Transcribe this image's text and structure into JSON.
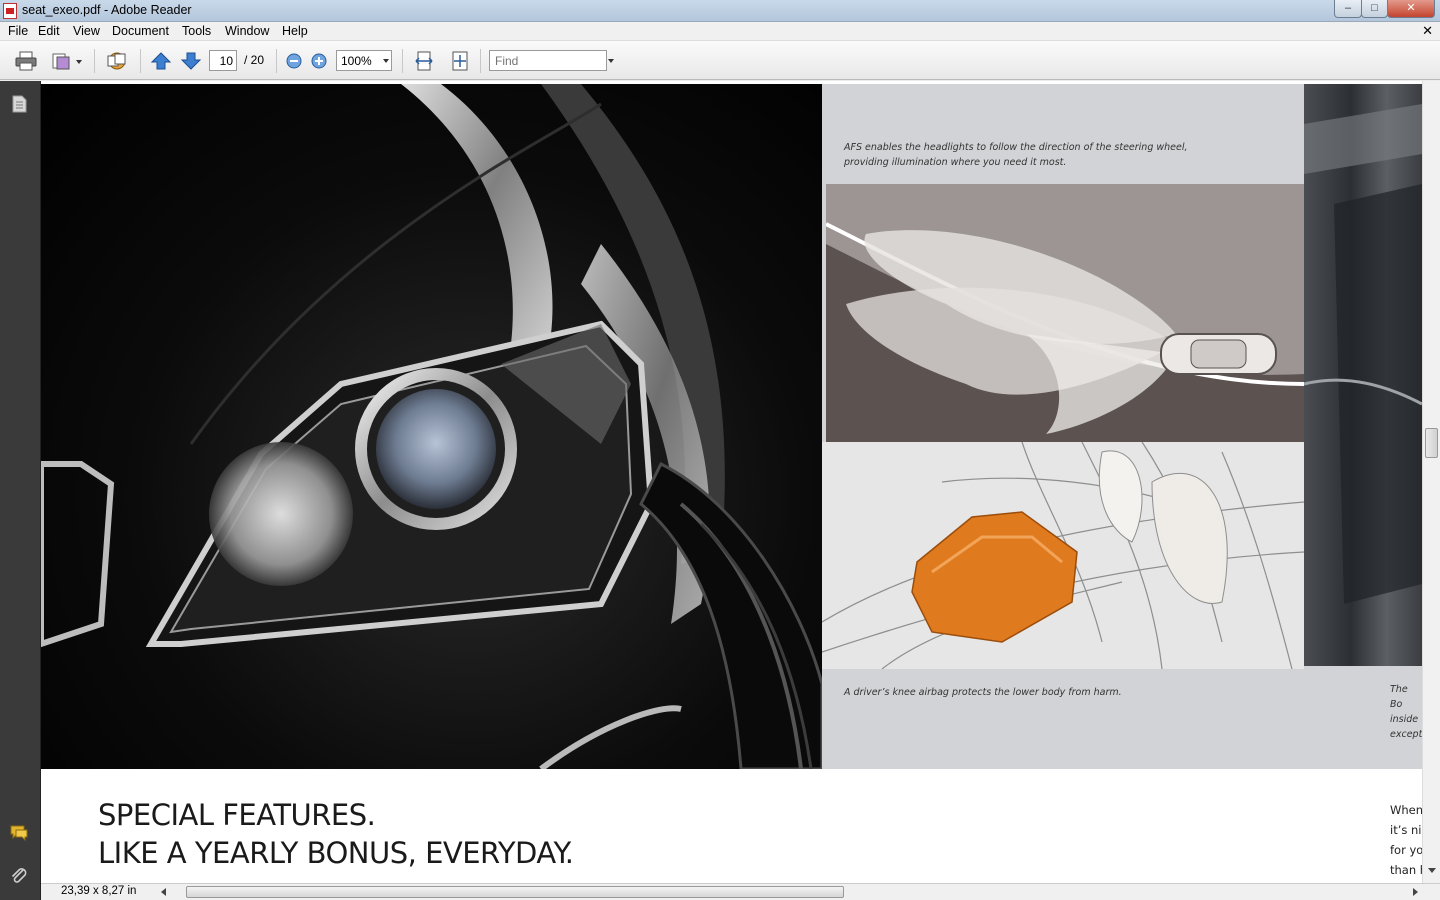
{
  "window": {
    "title": "seat_exeo.pdf - Adobe Reader",
    "controls": {
      "minimize": "–",
      "maximize": "□",
      "close": "✕"
    }
  },
  "menu": {
    "items": [
      "File",
      "Edit",
      "View",
      "Document",
      "Tools",
      "Window",
      "Help"
    ],
    "close": "✕"
  },
  "toolbar": {
    "icons": [
      "print-icon",
      "pages-icon",
      "collaborate-icon",
      "previous-page-icon",
      "next-page-icon",
      "zoom-out-icon",
      "zoom-in-icon",
      "fit-width-icon",
      "fit-page-icon"
    ],
    "page_current": "10",
    "page_total": "/ 20",
    "zoom": "100%",
    "find_placeholder": "Find"
  },
  "document": {
    "caption_afs": "AFS enables the headlights to follow the direction of the steering wheel,\nproviding illumination where you need it most.",
    "caption_airbag": "A driver’s knee airbag protects the lower body from harm.",
    "caption_right_cut": "The Bo\ninside \nexcept",
    "headline_line1": "SPECIAL FEATURES.",
    "headline_line2": "LIKE A YEARLY BONUS, EVERYDAY.",
    "body_cut": "When\nit’s ni\nfor yo\nthan h"
  },
  "status": {
    "page_size": "23,39 x 8,27 in"
  },
  "colors": {
    "airbag_accent": "#e07a1f",
    "panel_gray": "#d2d3d6",
    "nav_dark": "#3a3a3a"
  }
}
